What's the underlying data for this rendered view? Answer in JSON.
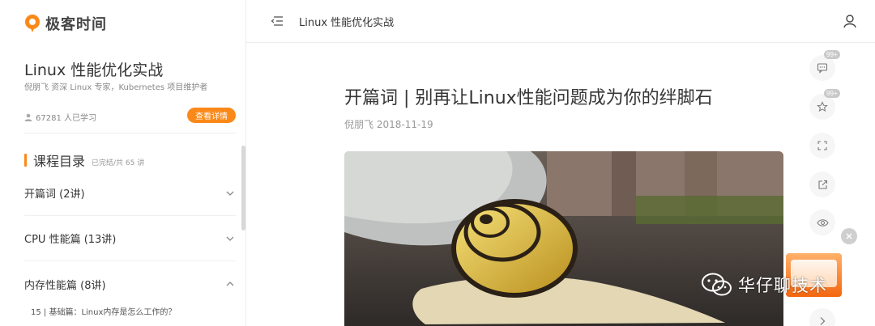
{
  "brand": {
    "name": "极客时间",
    "accent": "#fa8919"
  },
  "sidebar": {
    "course_title": "Linux 性能优化实战",
    "author": "倪朋飞  资深 Linux 专家，Kubernetes 项目维护者",
    "learners": "67281 人已学习",
    "detail_button": "查看详情",
    "toc_title": "课程目录",
    "toc_status": "已完结/共 65 讲",
    "sections": [
      {
        "label": "开篇词 (2讲)",
        "expanded": false
      },
      {
        "label": "CPU 性能篇 (13讲)",
        "expanded": false
      },
      {
        "label": "内存性能篇 (8讲)",
        "expanded": true
      }
    ],
    "lesson": "15 | 基础篇：Linux内存是怎么工作的？"
  },
  "topbar": {
    "title": "Linux 性能优化实战"
  },
  "article": {
    "title": "开篇词 | 别再让Linux性能问题成为你的绊脚石",
    "author": "倪朋飞",
    "date": "2018-11-19"
  },
  "rail": [
    {
      "icon": "comment-icon",
      "badge": "99+"
    },
    {
      "icon": "star-icon",
      "badge": "99+"
    },
    {
      "icon": "fullscreen-icon",
      "badge": ""
    },
    {
      "icon": "share-icon",
      "badge": ""
    },
    {
      "icon": "eye-icon",
      "badge": ""
    },
    {
      "icon": "chevron-right-icon",
      "badge": ""
    }
  ],
  "watermark": {
    "text": "华仔聊技术"
  }
}
